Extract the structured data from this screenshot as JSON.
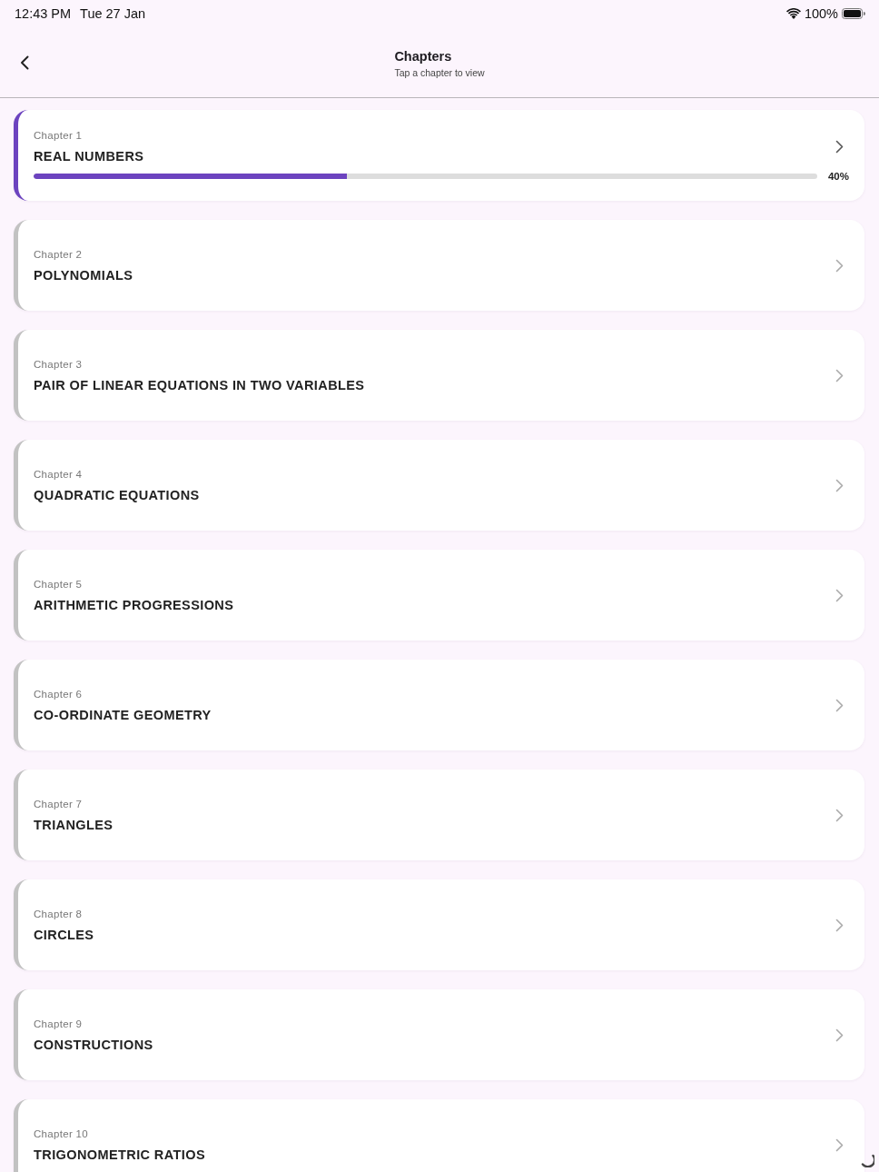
{
  "status_bar": {
    "time": "12:43 PM",
    "date": "Tue 27 Jan",
    "battery": "100%"
  },
  "header": {
    "title": "Chapters",
    "subtitle": "Tap a chapter to view"
  },
  "chapters": [
    {
      "label": "Chapter 1",
      "title": "REAL NUMBERS",
      "in_progress": true,
      "progress": {
        "level": 0.4,
        "reading": "40%"
      }
    },
    {
      "label": "Chapter 2",
      "title": "POLYNOMIALS",
      "in_progress": false
    },
    {
      "label": "Chapter 3",
      "title": "PAIR OF LINEAR EQUATIONS IN TWO VARIABLES",
      "in_progress": false
    },
    {
      "label": "Chapter 4",
      "title": "QUADRATIC EQUATIONS",
      "in_progress": false
    },
    {
      "label": "Chapter 5",
      "title": "ARITHMETIC PROGRESSIONS",
      "in_progress": false
    },
    {
      "label": "Chapter 6",
      "title": "CO-ORDINATE GEOMETRY",
      "in_progress": false
    },
    {
      "label": "Chapter 7",
      "title": "TRIANGLES",
      "in_progress": false
    },
    {
      "label": "Chapter 8",
      "title": "CIRCLES",
      "in_progress": false
    },
    {
      "label": "Chapter 9",
      "title": "CONSTRUCTIONS",
      "in_progress": false
    },
    {
      "label": "Chapter 10",
      "title": "TRIGONOMETRIC RATIOS",
      "in_progress": false
    }
  ]
}
